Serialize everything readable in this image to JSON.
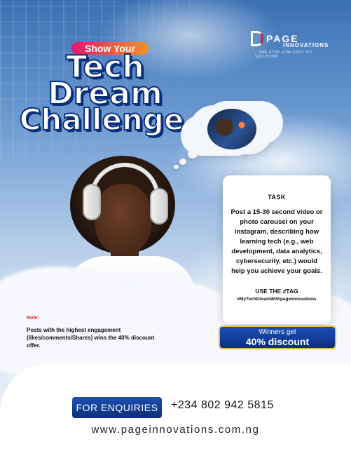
{
  "header": {
    "kicker": "Show Your",
    "title_line1": "Tech",
    "title_line2": "Dream",
    "title_line3": "Challenge"
  },
  "logo": {
    "name": "PAGE",
    "sub": "INNOVATIONS",
    "tagline": "...ONE STOP, LOW COST, ICT SOLUTIONS"
  },
  "task": {
    "title": "TASK",
    "body": "Post a 15-30 second video or photo carousel on your instagram, describing how learning tech (e.g., web development, data analytics, cybersecurity, etc.) would help you achieve your goals.",
    "use_label": "USE THE #TAG",
    "hashtag": "#MyTechDreamWithpageinnovations"
  },
  "prize": {
    "line1": "Winners get",
    "line2": "40% discount"
  },
  "note": {
    "label": "Note:",
    "text": "Posts with the highest engagement (likes/comments/Shares) wins the 40% discount offer."
  },
  "contact": {
    "button_label": "FOR ENQUIRIES",
    "phone": "+234 802 942 5815",
    "website": "www.pageinnovations.com.ng"
  },
  "colors": {
    "brand_blue": "#0d2d78",
    "accent_pink": "#e2186f",
    "accent_orange": "#f7931e",
    "note_red": "#d1202f",
    "gold_border": "#e9b84a"
  }
}
